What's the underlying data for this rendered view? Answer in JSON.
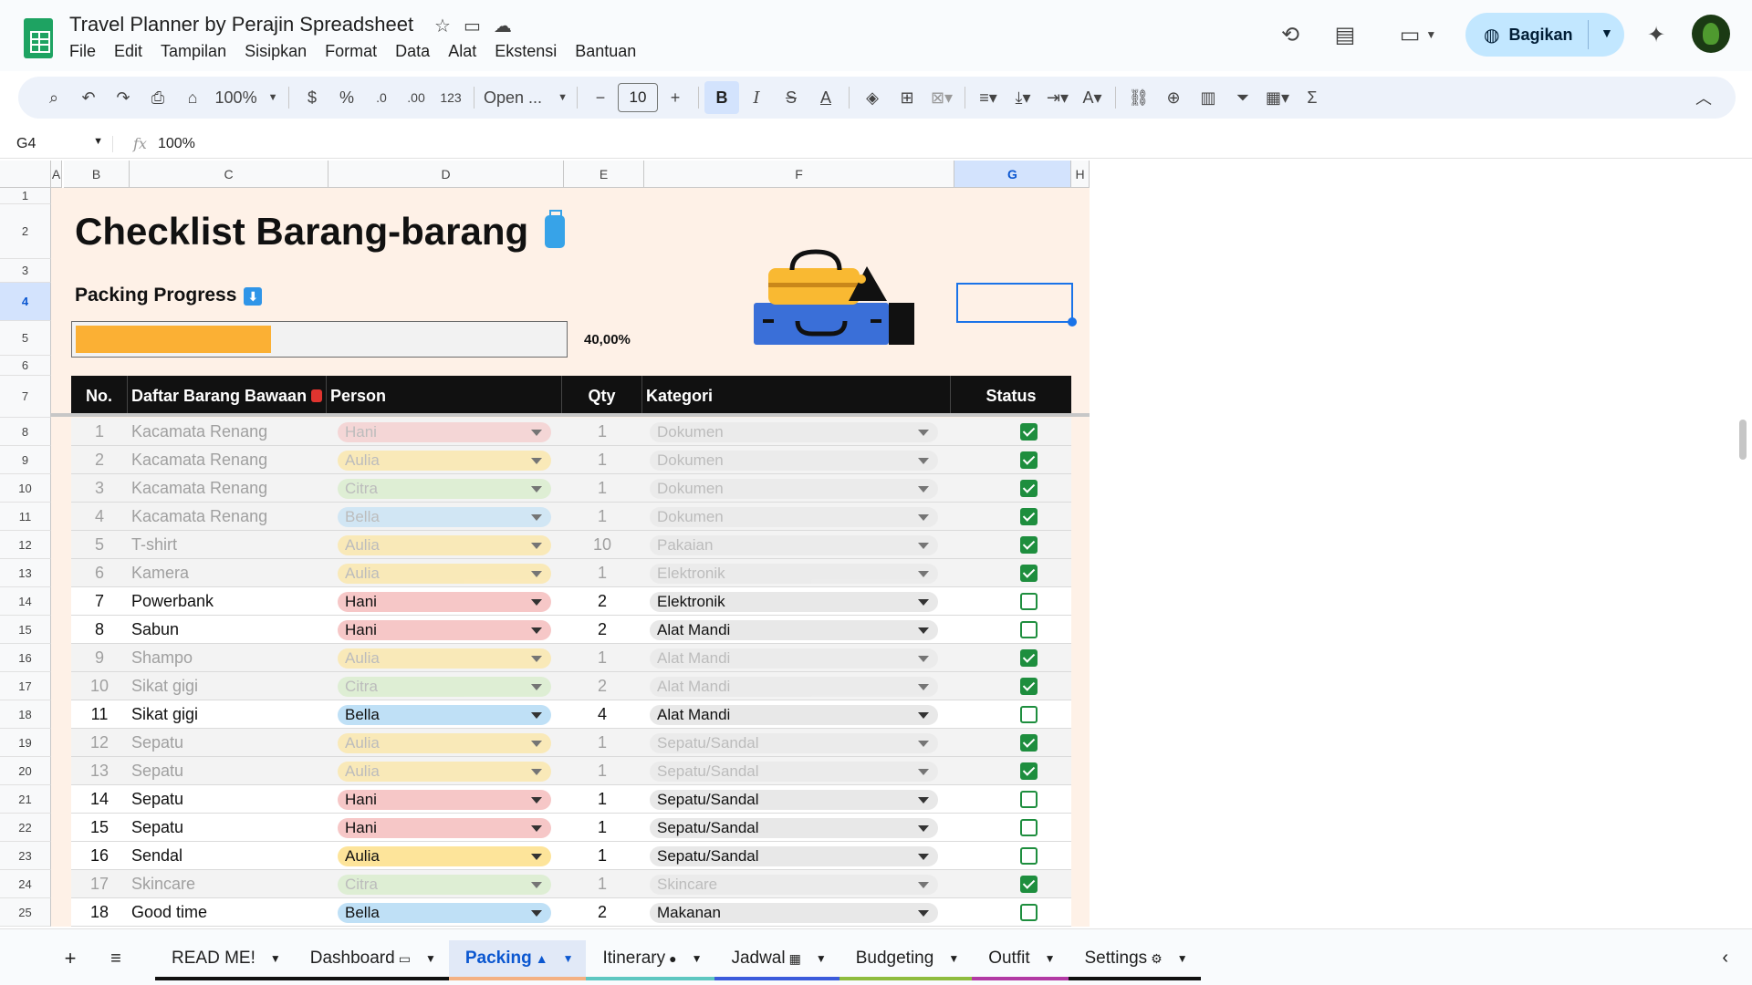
{
  "app": {
    "doc_title": "Travel Planner by Perajin Spreadsheet",
    "menu": [
      "File",
      "Edit",
      "Tampilan",
      "Sisipkan",
      "Format",
      "Data",
      "Alat",
      "Ekstensi",
      "Bantuan"
    ],
    "share_label": "Bagikan"
  },
  "toolbar": {
    "zoom": "100%",
    "currency": "$",
    "percent": "%",
    "dec_decrease": ".0",
    "dec_increase": ".00",
    "number_format": "123",
    "font": "Open ...",
    "font_size": "10",
    "bold": "B",
    "italic": "I",
    "text_color": "A"
  },
  "formula_bar": {
    "cell_ref": "G4",
    "fx": "fx",
    "value": "100%"
  },
  "columns": [
    "A",
    "B",
    "C",
    "D",
    "E",
    "F",
    "G",
    "H"
  ],
  "selected_column": "G",
  "rows": [
    "1",
    "2",
    "3",
    "4",
    "5",
    "6",
    "7",
    "8",
    "9",
    "10",
    "11",
    "12",
    "13",
    "14",
    "15",
    "16",
    "17",
    "18",
    "19",
    "20",
    "21",
    "22",
    "23",
    "24",
    "25"
  ],
  "selected_row": "4",
  "sheet": {
    "title": "Checklist Barang-barang",
    "subtitle": "Packing Progress",
    "progress_fraction": 0.4,
    "progress_label": "40,00%",
    "headers": {
      "no": "No.",
      "item": "Daftar Barang Bawaan",
      "person": "Person",
      "qty": "Qty",
      "category": "Kategori",
      "status": "Status"
    },
    "items": [
      {
        "no": "1",
        "item": "Kacamata Renang",
        "person": "Hani",
        "qty": "1",
        "category": "Dokumen",
        "done": true
      },
      {
        "no": "2",
        "item": "Kacamata Renang",
        "person": "Aulia",
        "qty": "1",
        "category": "Dokumen",
        "done": true
      },
      {
        "no": "3",
        "item": "Kacamata Renang",
        "person": "Citra",
        "qty": "1",
        "category": "Dokumen",
        "done": true
      },
      {
        "no": "4",
        "item": "Kacamata Renang",
        "person": "Bella",
        "qty": "1",
        "category": "Dokumen",
        "done": true
      },
      {
        "no": "5",
        "item": "T-shirt",
        "person": "Aulia",
        "qty": "10",
        "category": "Pakaian",
        "done": true
      },
      {
        "no": "6",
        "item": "Kamera",
        "person": "Aulia",
        "qty": "1",
        "category": "Elektronik",
        "done": true
      },
      {
        "no": "7",
        "item": "Powerbank",
        "person": "Hani",
        "qty": "2",
        "category": "Elektronik",
        "done": false
      },
      {
        "no": "8",
        "item": "Sabun",
        "person": "Hani",
        "qty": "2",
        "category": "Alat Mandi",
        "done": false
      },
      {
        "no": "9",
        "item": "Shampo",
        "person": "Aulia",
        "qty": "1",
        "category": "Alat Mandi",
        "done": true
      },
      {
        "no": "10",
        "item": "Sikat gigi",
        "person": "Citra",
        "qty": "2",
        "category": "Alat Mandi",
        "done": true
      },
      {
        "no": "11",
        "item": "Sikat gigi",
        "person": "Bella",
        "qty": "4",
        "category": "Alat Mandi",
        "done": false
      },
      {
        "no": "12",
        "item": "Sepatu",
        "person": "Aulia",
        "qty": "1",
        "category": "Sepatu/Sandal",
        "done": true
      },
      {
        "no": "13",
        "item": "Sepatu",
        "person": "Aulia",
        "qty": "1",
        "category": "Sepatu/Sandal",
        "done": true
      },
      {
        "no": "14",
        "item": "Sepatu",
        "person": "Hani",
        "qty": "1",
        "category": "Sepatu/Sandal",
        "done": false
      },
      {
        "no": "15",
        "item": "Sepatu",
        "person": "Hani",
        "qty": "1",
        "category": "Sepatu/Sandal",
        "done": false
      },
      {
        "no": "16",
        "item": "Sendal",
        "person": "Aulia",
        "qty": "1",
        "category": "Sepatu/Sandal",
        "done": false
      },
      {
        "no": "17",
        "item": "Skincare",
        "person": "Citra",
        "qty": "1",
        "category": "Skincare",
        "done": true
      },
      {
        "no": "18",
        "item": "Good time",
        "person": "Bella",
        "qty": "2",
        "category": "Makanan",
        "done": false
      }
    ]
  },
  "person_colors": {
    "Hani": "#f6c7c7",
    "Aulia": "#fde49a",
    "Citra": "#d3ecc4",
    "Bella": "#bfe0f6"
  },
  "tabs": [
    {
      "label": "READ ME!",
      "color": "#111111",
      "active": false
    },
    {
      "label": "Dashboard",
      "color": "#111111",
      "active": false
    },
    {
      "label": "Packing",
      "color": "#f4b183",
      "active": true
    },
    {
      "label": "Itinerary",
      "color": "#5ec7c1",
      "active": false
    },
    {
      "label": "Jadwal",
      "color": "#3b5bdb",
      "active": false
    },
    {
      "label": "Budgeting",
      "color": "#8fbc3f",
      "active": false
    },
    {
      "label": "Outfit",
      "color": "#b23aa4",
      "active": false
    },
    {
      "label": "Settings",
      "color": "#111111",
      "active": false
    }
  ]
}
